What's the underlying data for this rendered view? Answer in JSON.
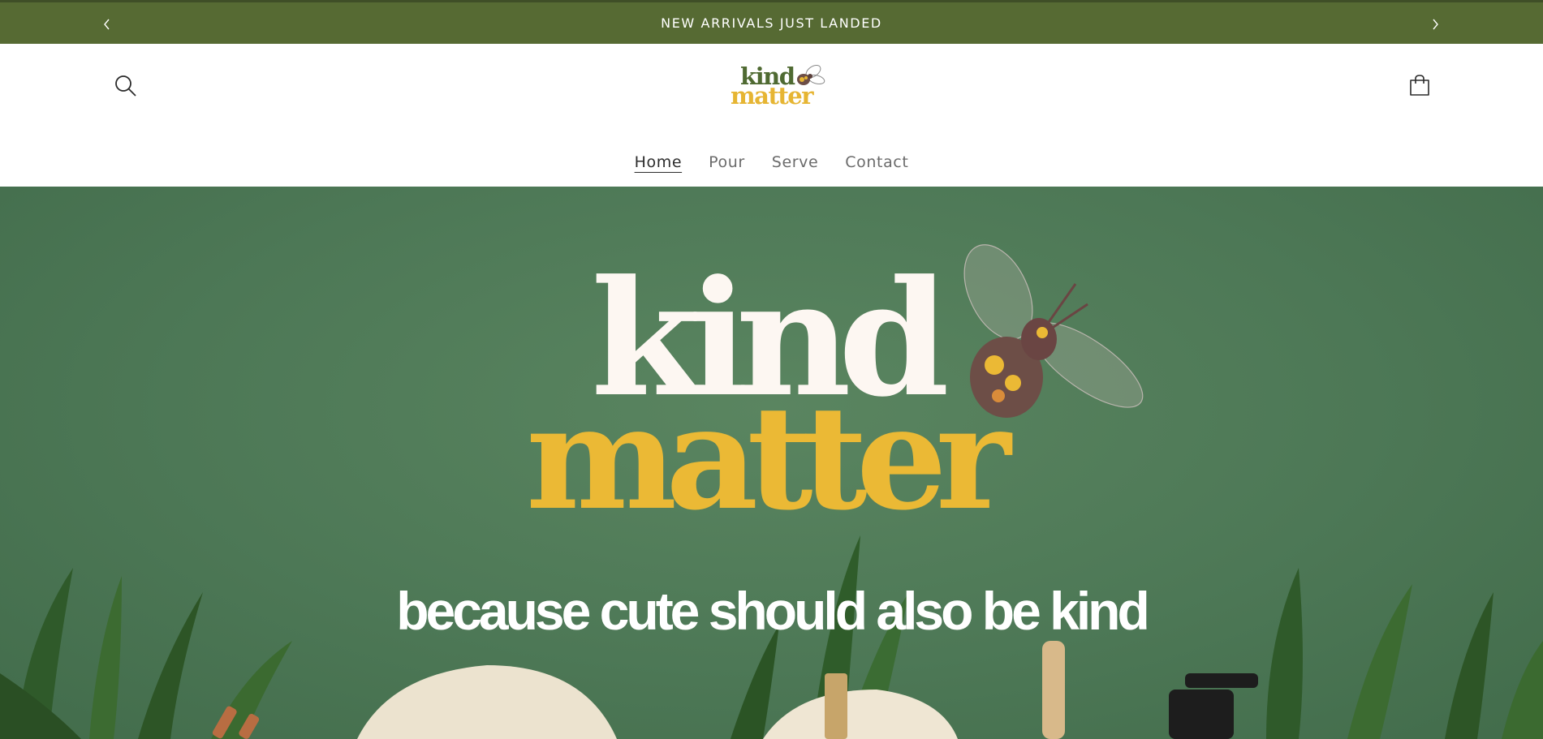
{
  "announcement": {
    "text": "NEW ARRIVALS JUST LANDED",
    "prev_icon": "chevron-left-icon",
    "next_icon": "chevron-right-icon"
  },
  "header": {
    "search_icon": "search-icon",
    "cart_icon": "cart-icon",
    "logo": {
      "line1": "kind",
      "line2": "matter"
    }
  },
  "nav": {
    "items": [
      {
        "label": "Home",
        "active": true
      },
      {
        "label": "Pour",
        "active": false
      },
      {
        "label": "Serve",
        "active": false
      },
      {
        "label": "Contact",
        "active": false
      }
    ]
  },
  "hero": {
    "title_line1": "kind",
    "title_line2": "matter",
    "tagline": "because cute should also be kind"
  },
  "colors": {
    "announcement_bg": "#566a33",
    "hero_bg": "#4d7856",
    "brand_green": "#4f6a32",
    "brand_yellow": "#e6b533",
    "title_cream": "#fdf7f2"
  }
}
